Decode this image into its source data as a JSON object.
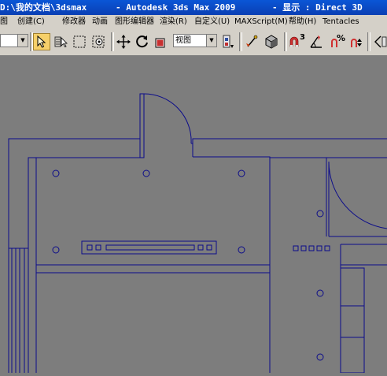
{
  "window": {
    "path": "D:\\我的文档\\3dsmax",
    "app_title": "- Autodesk 3ds Max  2009",
    "display_mode": "- 显示 : Direct 3D"
  },
  "menu": {
    "items": [
      "图",
      "创建(C)",
      "修改器",
      "动画",
      "图形编辑器",
      "渲染(R)",
      "自定义(U)",
      "MAXScript(M)",
      "帮助(H)",
      "Tentacles"
    ]
  },
  "toolbar": {
    "selection_filter": "",
    "coord_system": "视图",
    "snap_label": "3",
    "percent_label": "%"
  },
  "colors": {
    "title_bg": "#0a4bc8",
    "toolbar_bg": "#d4d0c8",
    "viewport_bg": "#7d7d7d",
    "line": "#0c0c8a",
    "active_tool": "#f6d06a"
  }
}
